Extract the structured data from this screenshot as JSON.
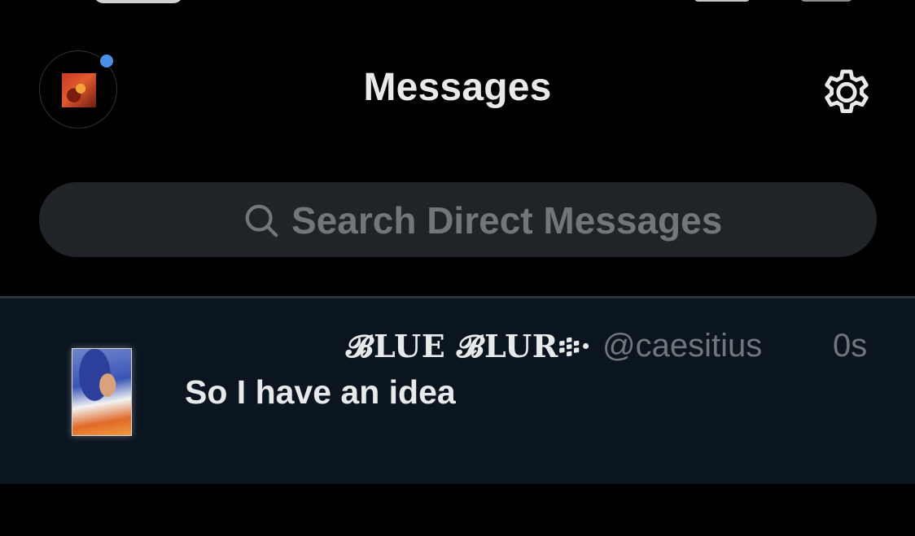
{
  "header": {
    "title": "Messages",
    "avatar_has_notification": true,
    "accent_color": "#4a8fe7"
  },
  "icons": {
    "settings": "gear-icon",
    "search": "search-icon",
    "notification": "notification-dot"
  },
  "search": {
    "placeholder": "Search Direct Messages"
  },
  "conversations": [
    {
      "display_name": "𝓑LUE 𝓑LUR፨·",
      "handle": "@caesitius",
      "time": "0s",
      "preview": "So I have an idea"
    }
  ]
}
